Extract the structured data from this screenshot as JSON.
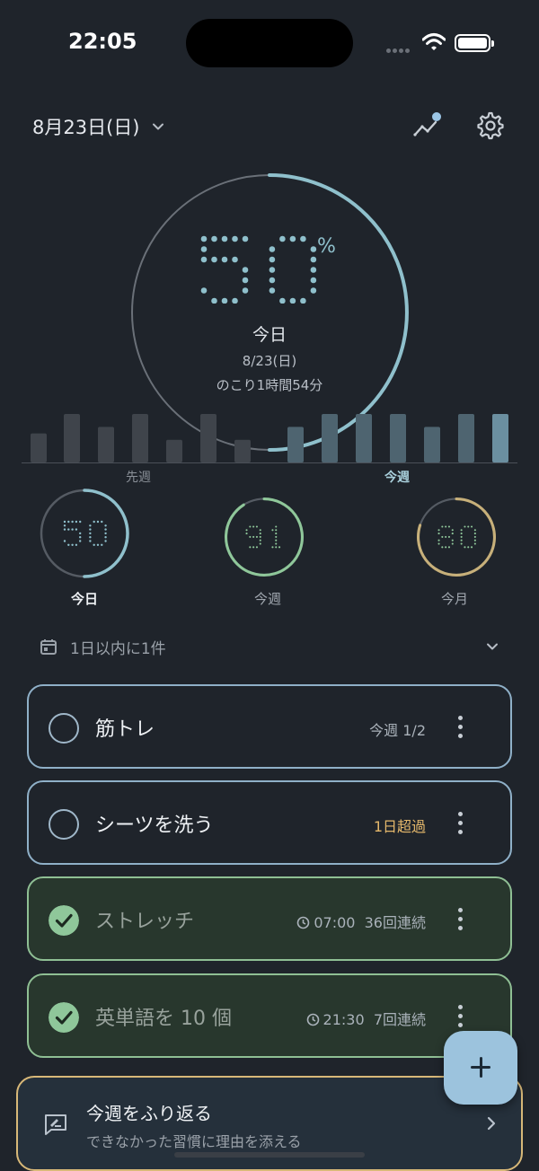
{
  "status_bar": {
    "time": "22:05"
  },
  "header": {
    "date": "8月23日(日)"
  },
  "today_progress": {
    "percent": "50",
    "percent_sign": "%",
    "value": 0.5,
    "label": "今日",
    "date": "8/23(日)",
    "remaining": "のこり1時間54分"
  },
  "weekly_bars": {
    "last_week_label": "先週",
    "this_week_label": "今週",
    "last_week_values": [
      0.45,
      0.75,
      0.55,
      0.75,
      0.35,
      0.75,
      0.35
    ],
    "this_week_values": [
      0.55,
      0.75,
      0.75,
      0.75,
      0.55,
      0.75,
      0.75
    ]
  },
  "summary_rings": [
    {
      "value": "50",
      "fraction": 0.5,
      "label": "今日",
      "color": "#8fc0cc",
      "active": true
    },
    {
      "value": "91",
      "fraction": 0.91,
      "label": "今週",
      "color": "#8fc79a",
      "active": false
    },
    {
      "value": "80",
      "fraction": 0.8,
      "label": "今月",
      "color": "#c7b07a",
      "active": false
    }
  ],
  "due_filter": {
    "label": "1日以内に1件"
  },
  "habits": [
    {
      "name": "筋トレ",
      "meta": "今週 1/2",
      "done": false,
      "warn": false
    },
    {
      "name": "シーツを洗う",
      "meta": "1日超過",
      "done": false,
      "warn": true
    },
    {
      "name": "ストレッチ",
      "time": "07:00",
      "streak": "36回連続",
      "done": true
    },
    {
      "name": "英単語を 10 個",
      "time": "21:30",
      "streak": "7回連続",
      "done": true
    }
  ],
  "review_banner": {
    "title": "今週をふり返る",
    "subtitle": "できなかった習慣に理由を添える"
  },
  "colors": {
    "background": "#1f242b",
    "accent_blue": "#8fc0cc",
    "accent_green": "#8fc79a",
    "warning": "#e5b86b",
    "fab": "#9cc3dd"
  },
  "icons": [
    "chevron-down-icon",
    "trend-chart-icon",
    "gear-icon",
    "calendar-icon",
    "clock-icon",
    "check-icon",
    "kebab-menu-icon",
    "plus-icon",
    "review-note-icon",
    "chevron-right-icon"
  ]
}
